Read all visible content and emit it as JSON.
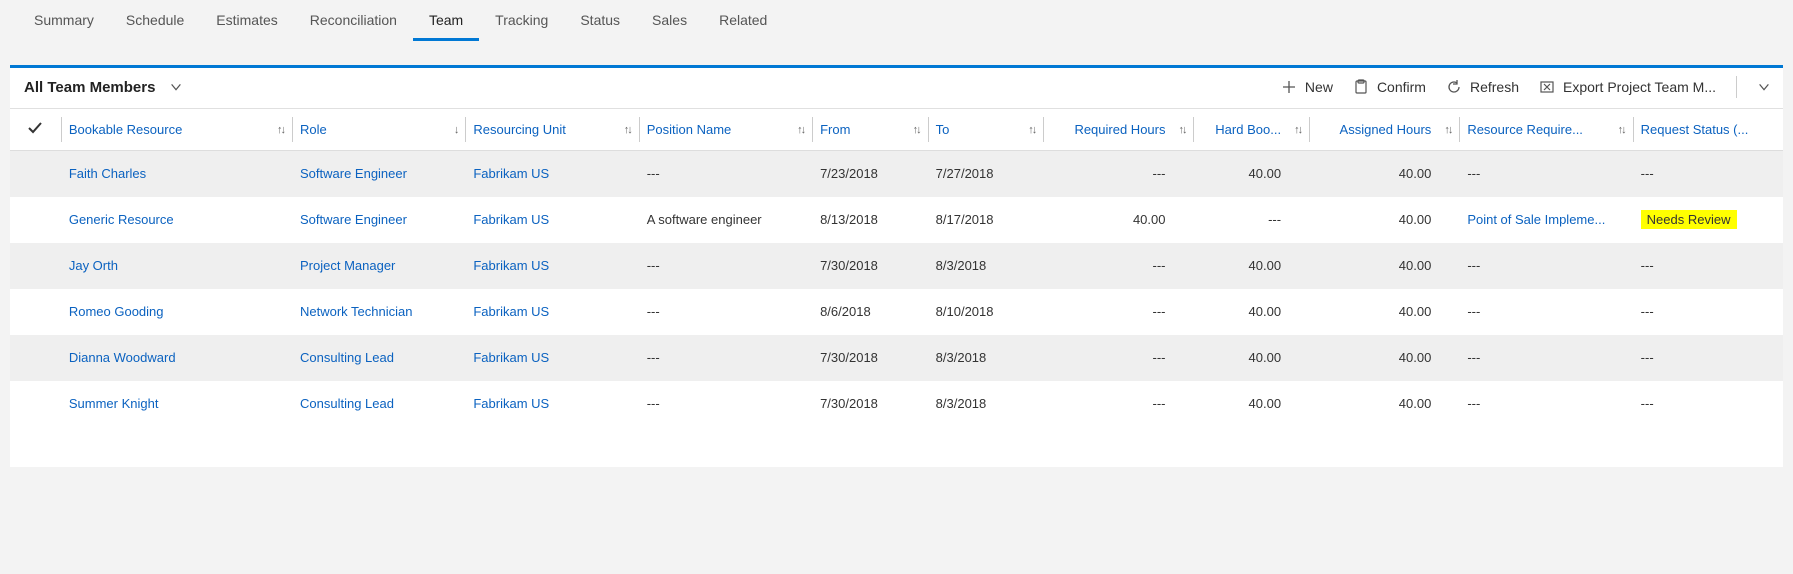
{
  "tabs": {
    "items": [
      "Summary",
      "Schedule",
      "Estimates",
      "Reconciliation",
      "Team",
      "Tracking",
      "Status",
      "Sales",
      "Related"
    ],
    "active": "Team"
  },
  "view": {
    "title": "All Team Members"
  },
  "commands": {
    "new": "New",
    "confirm": "Confirm",
    "refresh": "Refresh",
    "export": "Export Project Team M..."
  },
  "columns": {
    "bookable": "Bookable Resource",
    "role": "Role",
    "unit": "Resourcing Unit",
    "position": "Position Name",
    "from": "From",
    "to": "To",
    "required": "Required Hours",
    "hardbook": "Hard Boo...",
    "assigned": "Assigned Hours",
    "requirement": "Resource Require...",
    "status": "Request Status (..."
  },
  "rows": [
    {
      "bookable": "Faith Charles",
      "role": "Software Engineer",
      "unit": "Fabrikam US",
      "position": "---",
      "from": "7/23/2018",
      "to": "7/27/2018",
      "required": "---",
      "hardbook": "40.00",
      "assigned": "40.00",
      "requirement": "---",
      "status": "---",
      "highlight": false
    },
    {
      "bookable": "Generic Resource",
      "role": "Software Engineer",
      "unit": "Fabrikam US",
      "position": "A software engineer",
      "from": "8/13/2018",
      "to": "8/17/2018",
      "required": "40.00",
      "hardbook": "---",
      "assigned": "40.00",
      "requirement": "Point of Sale Impleme...",
      "status": "Needs Review",
      "highlight": true
    },
    {
      "bookable": "Jay Orth",
      "role": "Project Manager",
      "unit": "Fabrikam US",
      "position": "---",
      "from": "7/30/2018",
      "to": "8/3/2018",
      "required": "---",
      "hardbook": "40.00",
      "assigned": "40.00",
      "requirement": "---",
      "status": "---",
      "highlight": false
    },
    {
      "bookable": "Romeo Gooding",
      "role": "Network Technician",
      "unit": "Fabrikam US",
      "position": "---",
      "from": "8/6/2018",
      "to": "8/10/2018",
      "required": "---",
      "hardbook": "40.00",
      "assigned": "40.00",
      "requirement": "---",
      "status": "---",
      "highlight": false
    },
    {
      "bookable": "Dianna Woodward",
      "role": "Consulting Lead",
      "unit": "Fabrikam US",
      "position": "---",
      "from": "7/30/2018",
      "to": "8/3/2018",
      "required": "---",
      "hardbook": "40.00",
      "assigned": "40.00",
      "requirement": "---",
      "status": "---",
      "highlight": false
    },
    {
      "bookable": "Summer Knight",
      "role": "Consulting Lead",
      "unit": "Fabrikam US",
      "position": "---",
      "from": "7/30/2018",
      "to": "8/3/2018",
      "required": "---",
      "hardbook": "40.00",
      "assigned": "40.00",
      "requirement": "---",
      "status": "---",
      "highlight": false
    }
  ]
}
